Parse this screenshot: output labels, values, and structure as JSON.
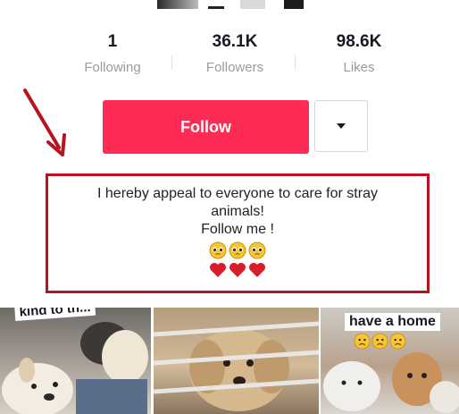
{
  "stats": [
    {
      "value": "1",
      "label": "Following"
    },
    {
      "value": "36.1K",
      "label": "Followers"
    },
    {
      "value": "98.6K",
      "label": "Likes"
    }
  ],
  "actions": {
    "follow_label": "Follow",
    "more_icon": "caret-down-icon"
  },
  "bio": {
    "line1": "I hereby appeal to everyone to care for stray",
    "line2": "animals!",
    "line3": "Follow me !",
    "emoji_row1": [
      "pleading-face",
      "pleading-face",
      "pleading-face"
    ],
    "emoji_row2": [
      "red-heart",
      "red-heart",
      "red-heart"
    ]
  },
  "annotation_color": "#b8131f",
  "accent_color": "#fe2c55",
  "videos": [
    {
      "caption": "kind to th..."
    },
    {
      "caption": ""
    },
    {
      "caption": "have a home",
      "emojis": [
        "frowning-face",
        "frowning-face",
        "frowning-face"
      ]
    }
  ]
}
